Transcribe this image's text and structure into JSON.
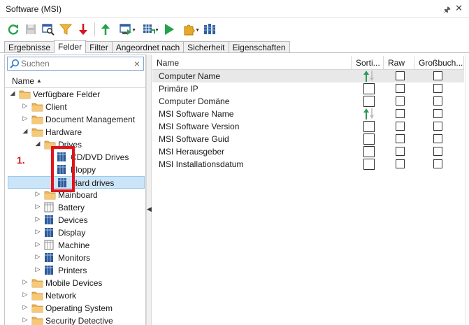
{
  "window": {
    "title": "Software (MSI)",
    "pin_glyph": "🖈",
    "close_glyph": "✕"
  },
  "colors": {
    "accent": "#2f7fd0",
    "folder": "#e9b25b",
    "green": "#24a34a",
    "red": "#d6151b",
    "selection": "#cce4f7"
  },
  "toolbar": {
    "buttons": [
      {
        "name": "refresh-icon"
      },
      {
        "name": "save-icon"
      },
      {
        "name": "search-window-icon"
      },
      {
        "name": "filter-icon"
      },
      {
        "name": "arrow-down-icon"
      },
      {
        "name": "arrow-up-icon"
      },
      {
        "name": "export-icon"
      },
      {
        "name": "grid-options-icon"
      },
      {
        "name": "play-icon"
      },
      {
        "name": "plugin-icon"
      },
      {
        "name": "columns-icon"
      }
    ]
  },
  "tabs": [
    "Ergebnisse",
    "Felder",
    "Filter",
    "Angeordnet nach",
    "Sicherheit",
    "Eigenschaften"
  ],
  "active_tab": "Felder",
  "search": {
    "placeholder": "Suchen",
    "clear": "×"
  },
  "tree": {
    "header": "Name",
    "nodes": [
      {
        "label": "Verfügbare Felder",
        "level": 0,
        "expander": "◢",
        "icon": "folder-icon"
      },
      {
        "label": "Client",
        "level": 1,
        "expander": "▷",
        "icon": "folder-icon"
      },
      {
        "label": "Document Management",
        "level": 1,
        "expander": "▷",
        "icon": "folder-icon"
      },
      {
        "label": "Hardware",
        "level": 1,
        "expander": "◢",
        "icon": "folder-icon"
      },
      {
        "label": "Drives",
        "level": 2,
        "expander": "◢",
        "icon": "folder-icon"
      },
      {
        "label": "CD/DVD Drives",
        "level": 3,
        "expander": "",
        "icon": "table-icon"
      },
      {
        "label": "Floppy",
        "level": 3,
        "expander": "",
        "icon": "table-icon"
      },
      {
        "label": "Hard drives",
        "level": 3,
        "expander": "",
        "icon": "table-icon",
        "selected": true
      },
      {
        "label": "Mainboard",
        "level": 2,
        "expander": "▷",
        "icon": "folder-icon"
      },
      {
        "label": "Battery",
        "level": 2,
        "expander": "▷",
        "icon": "table-outline-icon"
      },
      {
        "label": "Devices",
        "level": 2,
        "expander": "▷",
        "icon": "table-icon"
      },
      {
        "label": "Display",
        "level": 2,
        "expander": "▷",
        "icon": "table-icon"
      },
      {
        "label": "Machine",
        "level": 2,
        "expander": "▷",
        "icon": "table-outline-icon"
      },
      {
        "label": "Monitors",
        "level": 2,
        "expander": "▷",
        "icon": "table-icon"
      },
      {
        "label": "Printers",
        "level": 2,
        "expander": "▷",
        "icon": "table-icon"
      },
      {
        "label": "Mobile Devices",
        "level": 1,
        "expander": "▷",
        "icon": "folder-icon"
      },
      {
        "label": "Network",
        "level": 1,
        "expander": "▷",
        "icon": "folder-icon"
      },
      {
        "label": "Operating System",
        "level": 1,
        "expander": "▷",
        "icon": "folder-icon"
      },
      {
        "label": "Security Detective",
        "level": 1,
        "expander": "▷",
        "icon": "folder-icon"
      }
    ]
  },
  "annotation": {
    "label": "1."
  },
  "grid": {
    "columns": [
      "Name",
      "Sorti...",
      "Raw",
      "Großbuch..."
    ],
    "rows": [
      {
        "name": "Computer Name",
        "sort": "asc",
        "raw": false,
        "upper": false,
        "selected": true
      },
      {
        "name": "Primäre IP",
        "sort": "none",
        "raw": false,
        "upper": false
      },
      {
        "name": "Computer Domäne",
        "sort": "none",
        "raw": false,
        "upper": false
      },
      {
        "name": "MSI Software Name",
        "sort": "asc",
        "raw": false,
        "upper": false
      },
      {
        "name": "MSI Software Version",
        "sort": "none",
        "raw": false,
        "upper": false
      },
      {
        "name": "MSI Software Guid",
        "sort": "none",
        "raw": false,
        "upper": false
      },
      {
        "name": "MSI Herausgeber",
        "sort": "none",
        "raw": false,
        "upper": false
      },
      {
        "name": "MSI Installationsdatum",
        "sort": "none",
        "raw": false,
        "upper": false
      }
    ]
  }
}
